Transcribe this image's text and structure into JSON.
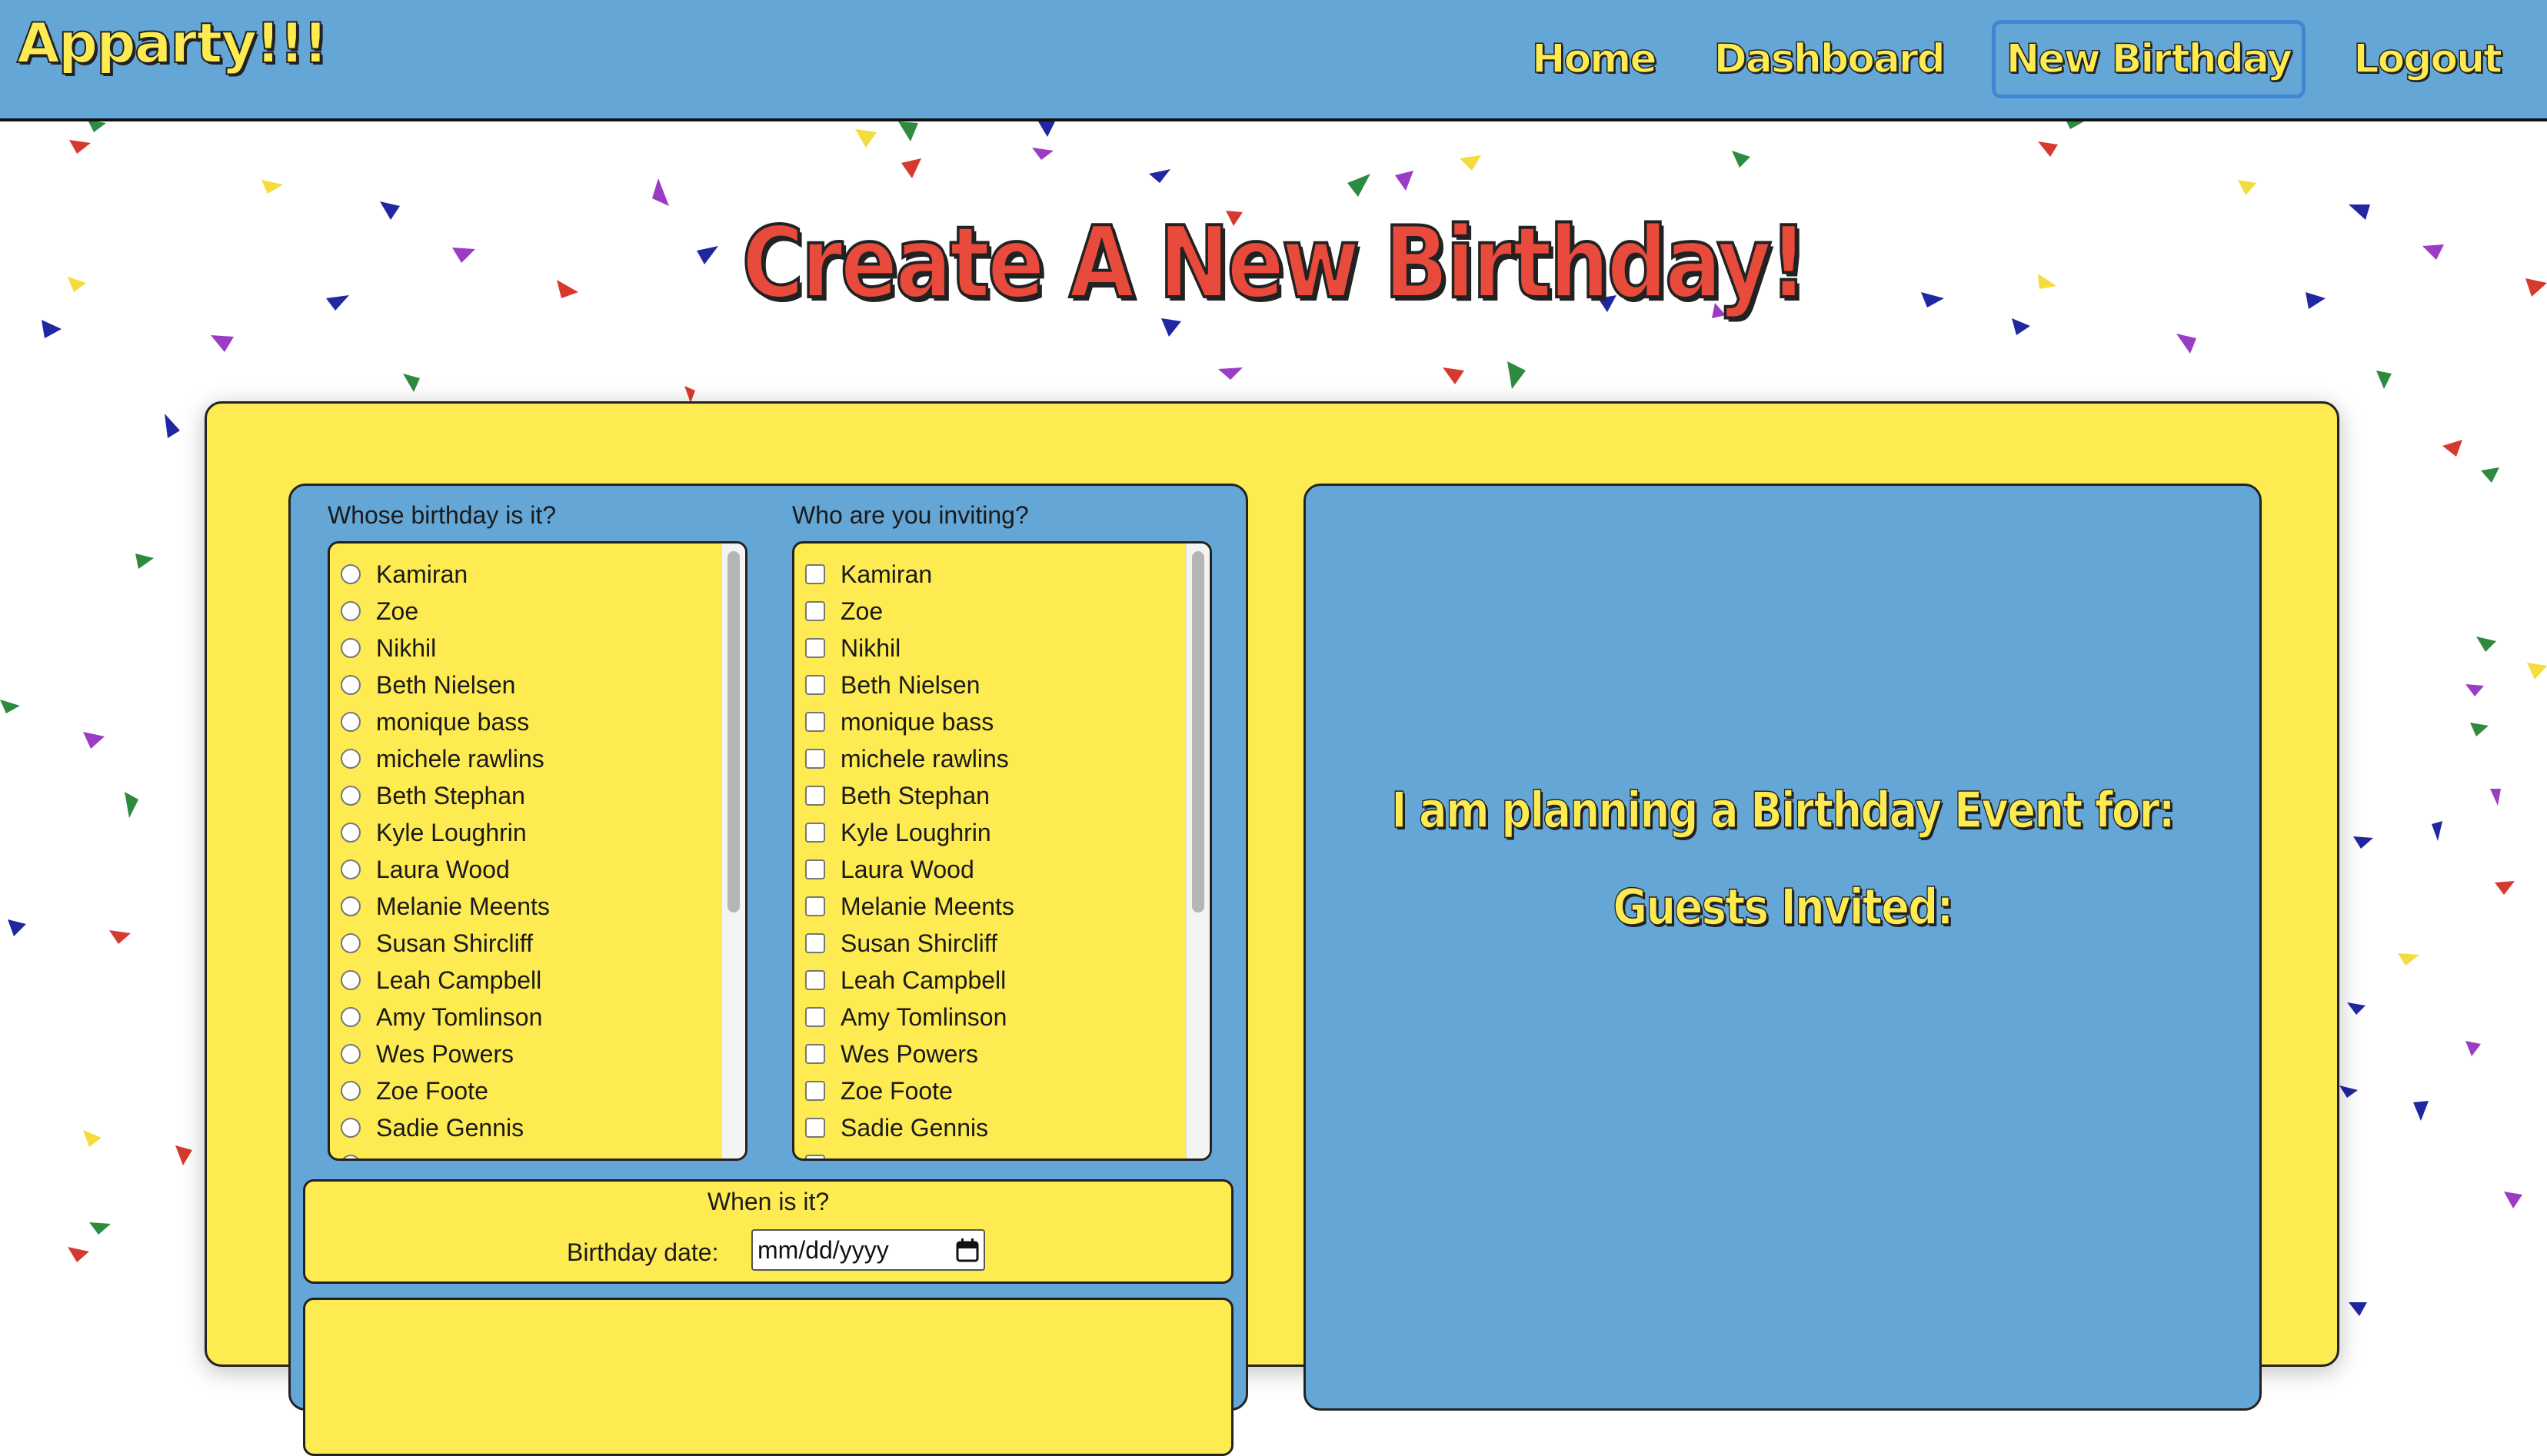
{
  "app": {
    "brand": "Apparty!!!"
  },
  "nav": {
    "items": [
      {
        "label": "Home"
      },
      {
        "label": "Dashboard"
      },
      {
        "label": "New Birthday",
        "active": true
      },
      {
        "label": "Logout"
      }
    ]
  },
  "page": {
    "title": "Create A New Birthday!"
  },
  "form": {
    "birthday_person": {
      "heading": "Whose birthday is it?",
      "options": [
        "Kamiran",
        "Zoe",
        "Nikhil",
        "Beth Nielsen",
        "monique bass",
        "michele rawlins",
        "Beth Stephan",
        "Kyle Loughrin",
        "Laura Wood",
        "Melanie Meents",
        "Susan Shircliff",
        "Leah Campbell",
        "Amy Tomlinson",
        "Wes Powers",
        "Zoe Foote",
        "Sadie Gennis"
      ]
    },
    "invitees": {
      "heading": "Who are you inviting?",
      "options": [
        "Kamiran",
        "Zoe",
        "Nikhil",
        "Beth Nielsen",
        "monique bass",
        "michele rawlins",
        "Beth Stephan",
        "Kyle Loughrin",
        "Laura Wood",
        "Melanie Meents",
        "Susan Shircliff",
        "Leah Campbell",
        "Amy Tomlinson",
        "Wes Powers",
        "Zoe Foote",
        "Sadie Gennis"
      ]
    },
    "when": {
      "heading": "When is it?",
      "date_label": "Birthday date:",
      "date_placeholder": "mm/dd/yyyy"
    }
  },
  "summary": {
    "planning_label": "I am planning a Birthday Event for:",
    "guests_label": "Guests Invited:"
  },
  "colors": {
    "nav_background": "#64a6d6",
    "brand_yellow": "#fdeb51",
    "title_red": "#e84a3b",
    "panel_blue": "#64a6d6",
    "card_yellow": "#fdeb51"
  },
  "icons": {
    "date_picker": "calendar-icon"
  }
}
